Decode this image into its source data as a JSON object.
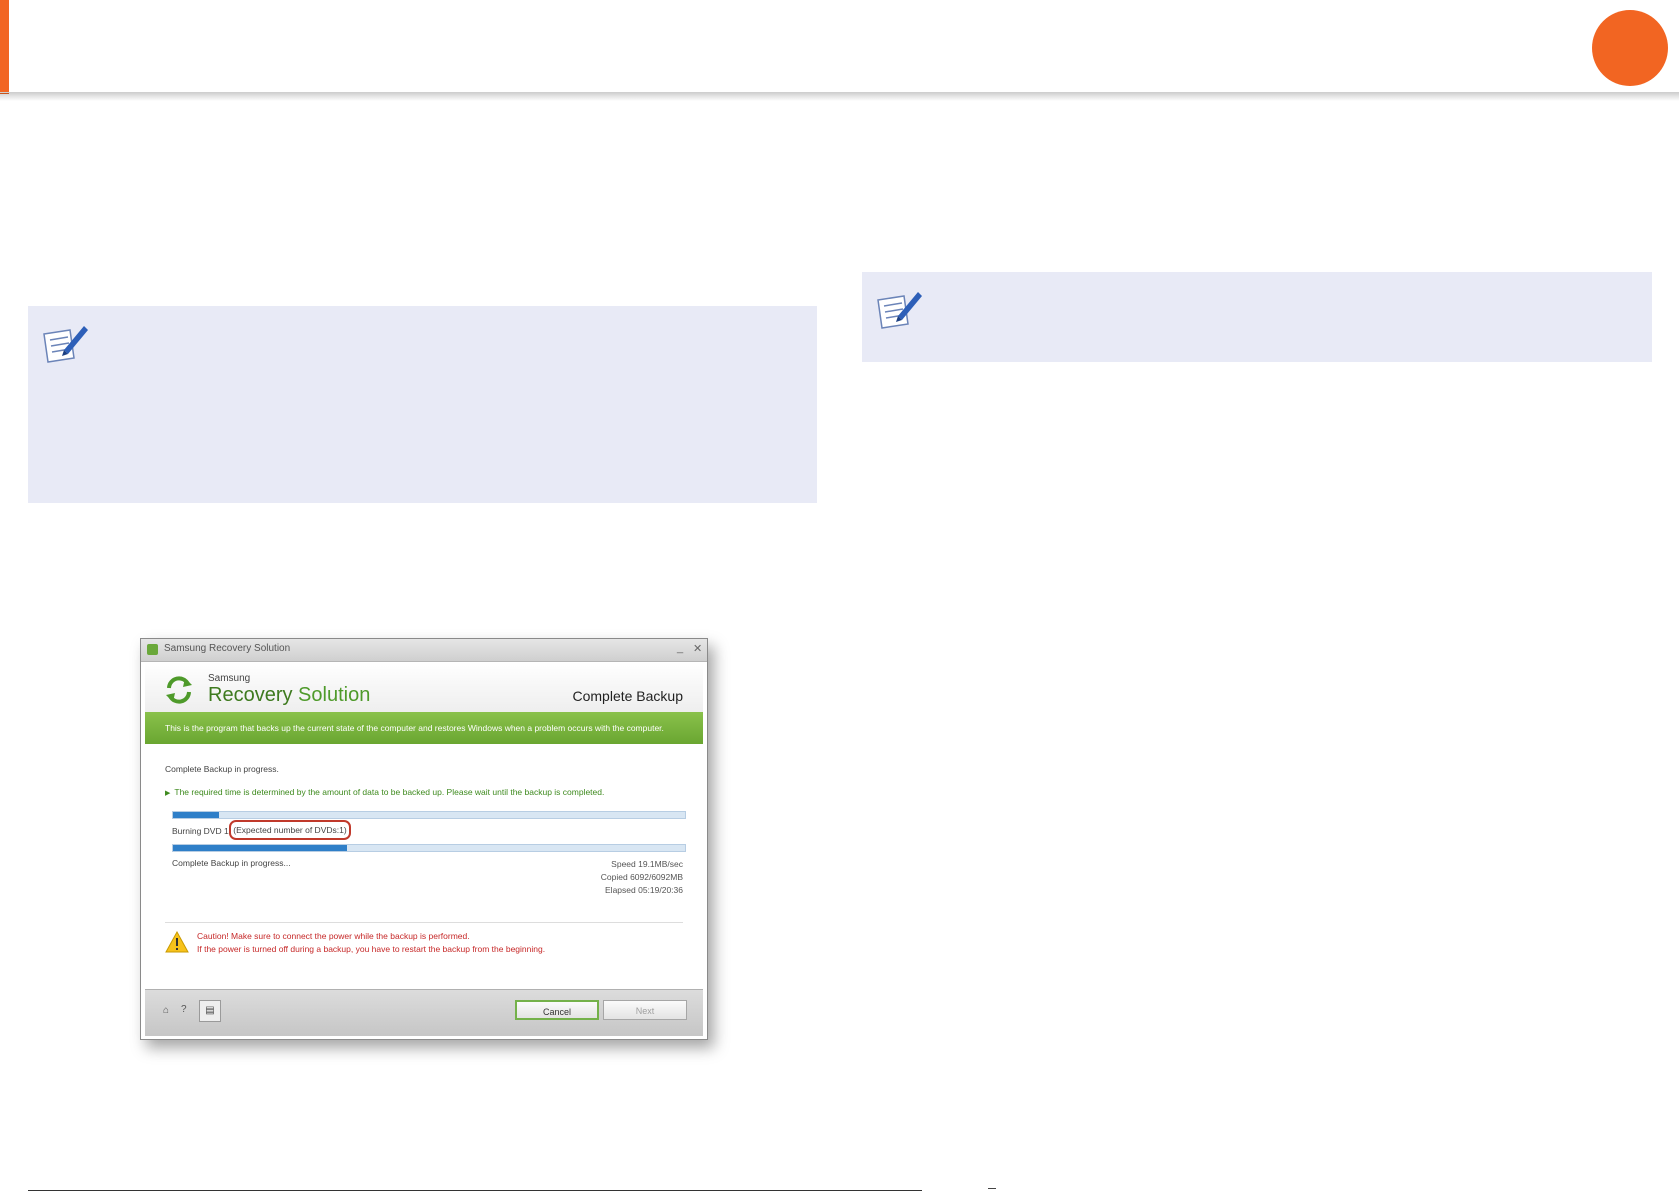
{
  "page": {
    "accent_color": "#f26522",
    "note_box_color": "#e8eaf6",
    "note_icon": "note-pencil-icon"
  },
  "window": {
    "title": "Samsung Recovery Solution",
    "minimize_glyph": "_",
    "close_glyph": "✕",
    "logo": {
      "brand": "Samsung",
      "product_part1": "Recovery",
      "product_part2": "Solution"
    },
    "screen_title": "Complete Backup",
    "banner": "This is the program that backs up the current state of the computer and restores Windows when a problem occurs with the computer.",
    "status_top": "Complete Backup in progress.",
    "hint": "The required time is determined by the amount of data to be backed up. Please wait until the backup is completed.",
    "progress_overall": 0.09,
    "burn_label": "Burning DVD 1",
    "expected_dvds": "(Expected number of DVDs:1)",
    "progress_dvd": 0.34,
    "status_bottom": "Complete Backup in progress...",
    "speed": "Speed 19.1MB/sec",
    "copied": "Copied 6092/6092MB",
    "elapsed": "Elapsed 05:19/20:36",
    "caution_line1": "Caution! Make sure to connect the power while the backup is performed.",
    "caution_line2": "If the power is turned off during a backup, you have to restart the backup from the beginning.",
    "footer": {
      "home_glyph": "⌂",
      "help_glyph": "?",
      "doc_glyph": "▤",
      "cancel_label": "Cancel",
      "next_label": "Next"
    },
    "colors": {
      "banner_green": "#6aa631",
      "progress_blue": "#2f7fc8",
      "caution_red": "#c62828",
      "highlight_red": "#c0392b"
    }
  }
}
